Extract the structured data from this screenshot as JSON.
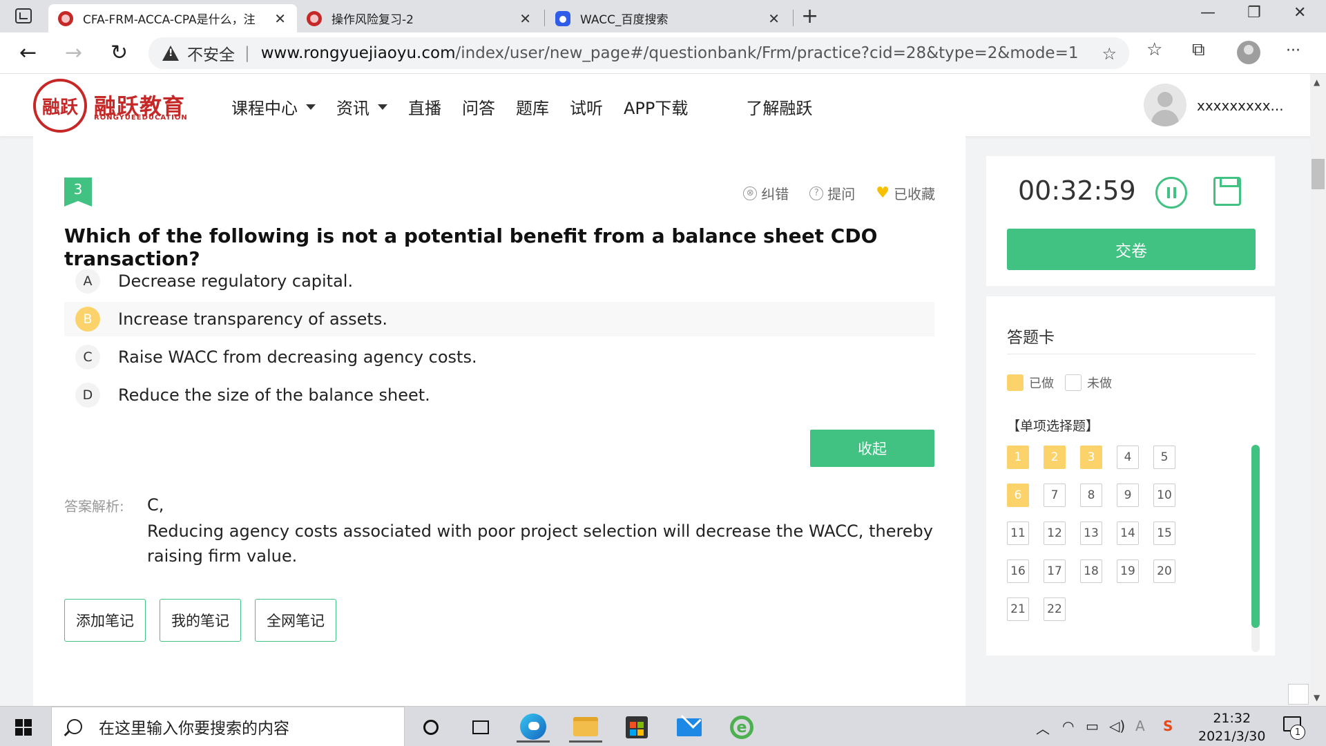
{
  "browser": {
    "tabs": [
      {
        "title": "CFA-FRM-ACCA-CPA是什么，注",
        "close": "✕"
      },
      {
        "title": "操作风险复习-2",
        "close": "✕"
      },
      {
        "title": "WACC_百度搜索",
        "close": "✕"
      }
    ],
    "new_tab": "+",
    "window_controls": {
      "minimize": "—",
      "maximize": "❐",
      "close": "✕"
    },
    "nav": {
      "back": "←",
      "forward": "→",
      "reload": "↻"
    },
    "security_label": "不安全",
    "url_sep": "|",
    "url_domain": "www.rongyuejiaoyu.com",
    "url_path": "/index/user/new_page#/questionbank/Frm/practice?cid=28&type=2&mode=1",
    "icons": {
      "favorite_add": "☆",
      "favorites": "☆",
      "collections": "⧉",
      "menu": "···"
    }
  },
  "site": {
    "logo_seal": "融跃",
    "logo_text": "融跃教育",
    "logo_sub": "RONGYUEEDUCATION",
    "nav": [
      {
        "label": "课程中心",
        "dropdown": true
      },
      {
        "label": "资讯",
        "dropdown": true
      },
      {
        "label": "直播"
      },
      {
        "label": "问答"
      },
      {
        "label": "题库"
      },
      {
        "label": "试听"
      },
      {
        "label": "APP下载"
      },
      {
        "label": "了解融跃"
      }
    ],
    "username": "xxxxxxxxx..."
  },
  "question": {
    "number": "3",
    "actions": {
      "report": "纠错",
      "ask": "提问",
      "favorited": "已收藏"
    },
    "action_icons": {
      "report": "⊗",
      "ask": "?",
      "favorited": "♥"
    },
    "text": "Which of the following is not a potential benefit from a balance sheet CDO transaction?",
    "options": [
      {
        "letter": "A",
        "text": "Decrease regulatory capital."
      },
      {
        "letter": "B",
        "text": "Increase transparency of assets.",
        "selected": true
      },
      {
        "letter": "C",
        "text": "Raise WACC from decreasing agency costs."
      },
      {
        "letter": "D",
        "text": "Reduce the size of the balance sheet."
      }
    ],
    "collapse_label": "收起",
    "analysis_label": "答案解析:",
    "answer": "C,",
    "explanation": "Reducing agency costs associated with poor project selection will decrease the WACC, thereby raising firm value.",
    "note_buttons": [
      "添加笔记",
      "我的笔记",
      "全网笔记"
    ]
  },
  "timer_panel": {
    "time": "00:32:59",
    "submit_label": "交卷"
  },
  "answer_card": {
    "title": "答题卡",
    "legend_done": "已做",
    "legend_todo": "未做",
    "section": "【单项选择题】",
    "items": [
      {
        "n": "1",
        "done": true
      },
      {
        "n": "2",
        "done": true
      },
      {
        "n": "3",
        "done": true
      },
      {
        "n": "4"
      },
      {
        "n": "5"
      },
      {
        "n": "6",
        "done": true
      },
      {
        "n": "7"
      },
      {
        "n": "8"
      },
      {
        "n": "9"
      },
      {
        "n": "10"
      },
      {
        "n": "11"
      },
      {
        "n": "12"
      },
      {
        "n": "13"
      },
      {
        "n": "14"
      },
      {
        "n": "15"
      },
      {
        "n": "16"
      },
      {
        "n": "17"
      },
      {
        "n": "18"
      },
      {
        "n": "19"
      },
      {
        "n": "20"
      },
      {
        "n": "21"
      },
      {
        "n": "22"
      }
    ]
  },
  "taskbar": {
    "search_placeholder": "在这里输入你要搜索的内容",
    "time": "21:32",
    "date": "2021/3/30",
    "notification_count": "1",
    "ime_label": "A"
  },
  "colors": {
    "accent": "#41c282",
    "answered": "#fcd36b",
    "brand": "#c62828"
  }
}
